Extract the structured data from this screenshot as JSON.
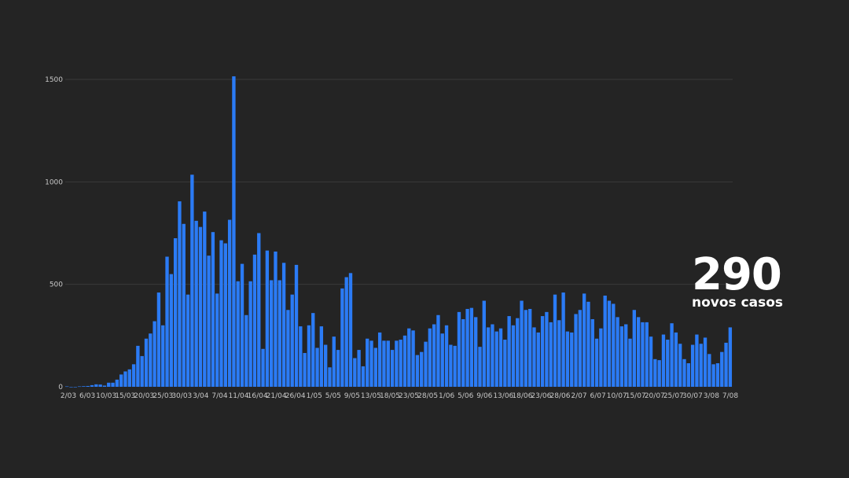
{
  "callout": {
    "value": "290",
    "label": "novos casos"
  },
  "colors": {
    "background": "#242424",
    "bar": "#2b7bf5",
    "grid": "#3a3a3a",
    "text": "#c8c8c8"
  },
  "chart_data": {
    "type": "bar",
    "title": "",
    "xlabel": "",
    "ylabel": "",
    "ylim": [
      0,
      1600
    ],
    "yticks": [
      0,
      500,
      1000,
      1500
    ],
    "grid": true,
    "tick_labels": [
      "2/03",
      "6/03",
      "10/03",
      "15/03",
      "20/03",
      "25/03",
      "30/03",
      "3/04",
      "7/04",
      "11/04",
      "16/04",
      "21/04",
      "26/04",
      "1/05",
      "5/05",
      "9/05",
      "13/05",
      "18/05",
      "23/05",
      "28/05",
      "1/06",
      "5/06",
      "9/06",
      "13/06",
      "18/06",
      "23/06",
      "28/06",
      "2/07",
      "6/07",
      "10/07",
      "15/07",
      "20/07",
      "25/07",
      "30/07",
      "3/08",
      "7/08"
    ],
    "values": [
      2,
      0,
      0,
      2,
      3,
      4,
      8,
      12,
      11,
      6,
      20,
      20,
      35,
      60,
      75,
      85,
      110,
      200,
      150,
      235,
      260,
      320,
      460,
      300,
      635,
      550,
      725,
      905,
      795,
      450,
      1035,
      810,
      780,
      855,
      640,
      755,
      455,
      715,
      700,
      815,
      1515,
      515,
      600,
      350,
      515,
      645,
      750,
      185,
      665,
      520,
      660,
      520,
      605,
      375,
      450,
      595,
      295,
      165,
      300,
      360,
      190,
      295,
      205,
      95,
      245,
      180,
      480,
      535,
      555,
      140,
      180,
      100,
      235,
      225,
      190,
      265,
      225,
      225,
      180,
      225,
      230,
      250,
      285,
      275,
      155,
      170,
      220,
      285,
      305,
      350,
      260,
      300,
      205,
      200,
      365,
      330,
      380,
      385,
      340,
      195,
      420,
      290,
      305,
      270,
      285,
      230,
      345,
      300,
      335,
      420,
      375,
      380,
      290,
      265,
      345,
      365,
      315,
      450,
      325,
      460,
      270,
      265,
      355,
      375,
      455,
      415,
      330,
      235,
      285,
      445,
      420,
      405,
      340,
      295,
      305,
      235,
      375,
      340,
      315,
      315,
      245,
      135,
      130,
      255,
      230,
      310,
      265,
      210,
      135,
      115,
      205,
      255,
      210,
      240,
      160,
      110,
      115,
      170,
      215,
      290
    ]
  }
}
